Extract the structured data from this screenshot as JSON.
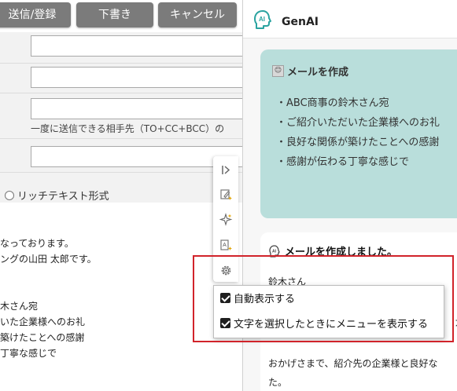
{
  "toolbar": {
    "send_label": "送信/登録",
    "draft_label": "下書き",
    "cancel_label": "キャンセル"
  },
  "form": {
    "recipient_hint": "一度に送信できる相手先（TO+CC+BCC）の",
    "format_option": "リッチテキスト形式"
  },
  "email_body": {
    "lines": [
      "なっております。",
      "ングの山田 太郎です。",
      "",
      "",
      "木さん宛",
      "いた企業様へのお礼",
      "築けたことへの感謝",
      "丁寧な感じで"
    ]
  },
  "genai_panel": {
    "title": "GenAI",
    "logo_text": "AI",
    "prompt": {
      "emoji": "😊",
      "title": "メールを作成",
      "bullets": [
        "・ABC商事の鈴木さん宛",
        "・ご紹介いただいた企業様へのお礼",
        "・良好な関係が築けたことへの感謝",
        "・感謝が伝わる丁寧な感じで"
      ]
    },
    "result": {
      "title": "メールを作成しました。",
      "greeting": "鈴木さん",
      "fragment": "カ",
      "line1": "おかげさまで、紹介先の企業様と良好な",
      "line2": "た。"
    }
  },
  "settings_menu": {
    "items": [
      {
        "label": "自動表示する",
        "checked": true
      },
      {
        "label": "文字を選択したときにメニューを表示する",
        "checked": true
      }
    ]
  },
  "colors": {
    "button_gray": "#7b7b7b",
    "prompt_card": "#b9dedb",
    "highlight": "#d1232a",
    "ai_logo": "#2aa3a0"
  }
}
